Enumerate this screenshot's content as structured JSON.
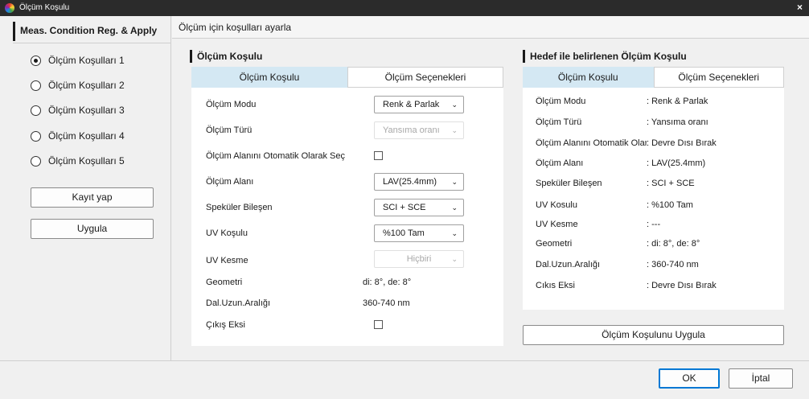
{
  "window": {
    "title": "Ölçüm Koşulu",
    "close": "×"
  },
  "left": {
    "header": "Meas. Condition Reg. & Apply",
    "conditions": [
      {
        "label": "Ölçüm Koşulları 1",
        "selected": true
      },
      {
        "label": "Ölçüm Koşulları 2",
        "selected": false
      },
      {
        "label": "Ölçüm Koşulları 3",
        "selected": false
      },
      {
        "label": "Ölçüm Koşulları 4",
        "selected": false
      },
      {
        "label": "Ölçüm Koşulları 5",
        "selected": false
      }
    ],
    "save_button": "Kayıt yap",
    "apply_button": "Uygula"
  },
  "right_header": "Ölçüm için koşulları ayarla",
  "condition_panel": {
    "title": "Ölçüm Koşulu",
    "tabs": [
      "Ölçüm Koşulu",
      "Ölçüm Seçenekleri"
    ],
    "fields": {
      "mode_label": "Ölçüm Modu",
      "mode_value": "Renk & Parlak",
      "type_label": "Ölçüm Türü",
      "type_value": "Yansıma oranı",
      "auto_area_label": "Ölçüm Alanını Otomatik Olarak Seç",
      "area_label": "Ölçüm Alanı",
      "area_value": "LAV(25.4mm)",
      "specular_label": "Speküler Bileşen",
      "specular_value": "SCI + SCE",
      "uv_label": "UV Koşulu",
      "uv_value": "%100 Tam",
      "uv_cut_label": "UV Kesme",
      "uv_cut_value": "Hiçbiri",
      "geometry_label": "Geometri",
      "geometry_value": "di: 8°, de: 8°",
      "wavelength_label": "Dal.Uzun.Aralığı",
      "wavelength_value": "360-740 nm",
      "output_label": "Çıkış Eksi"
    }
  },
  "target_panel": {
    "title": "Hedef ile belirlenen Ölçüm Koşulu",
    "tabs": [
      "Ölçüm Koşulu",
      "Ölçüm Seçenekleri"
    ],
    "rows": [
      {
        "label": "Ölçüm Modu",
        "value": ": Renk & Parlak"
      },
      {
        "label": "Ölçüm Türü",
        "value": ": Yansıma oranı"
      },
      {
        "label": "Ölçüm Alanını Otomatik Olarak Seç",
        "value": ": Devre Dısı Bırak"
      },
      {
        "label": "Ölçüm Alanı",
        "value": ": LAV(25.4mm)"
      },
      {
        "label": "Speküler Bileşen",
        "value": ": SCI + SCE"
      },
      {
        "label": "UV Kosulu",
        "value": ": %100 Tam"
      },
      {
        "label": "UV Kesme",
        "value": ": ---"
      },
      {
        "label": "Geometri",
        "value": ": di: 8°, de: 8°"
      },
      {
        "label": "Dal.Uzun.Aralığı",
        "value": ": 360-740 nm"
      },
      {
        "label": "Cıkıs Eksi",
        "value": ": Devre Dısı Bırak"
      }
    ],
    "apply_button": "Ölçüm Koşulunu Uygula"
  },
  "footer": {
    "ok": "OK",
    "cancel": "İptal"
  },
  "icons": {
    "dropdown": "chevron-down-icon",
    "app": "color-wheel-icon"
  }
}
